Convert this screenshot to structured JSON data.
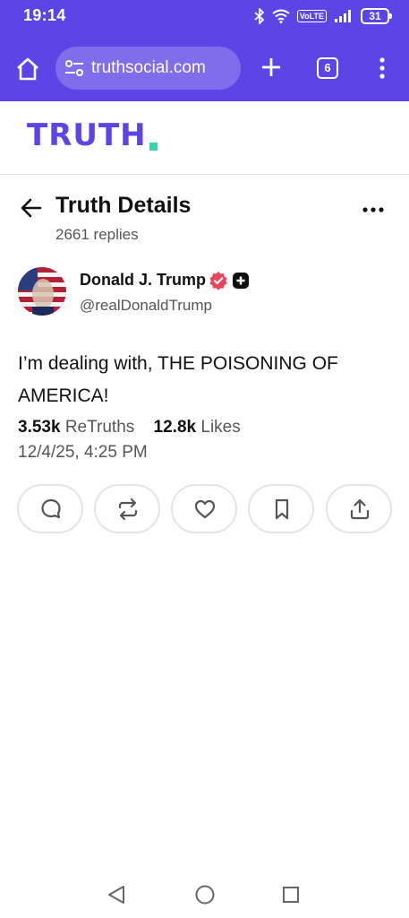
{
  "status_bar": {
    "time": "19:14",
    "network": "VoLTE",
    "battery": "31"
  },
  "browser": {
    "url": "truthsocial.com",
    "tab_count": "6"
  },
  "site": {
    "logo": "TRUTH",
    "brand_color": "#5b45e6",
    "accent_color": "#2fd6a8"
  },
  "page": {
    "title": "Truth Details",
    "replies": "2661 replies"
  },
  "post": {
    "author_name": "Donald J. Trump",
    "author_handle": "@realDonaldTrump",
    "text": "I’m dealing with, THE POISONING OF AMERICA!",
    "retruths_count": "3.53k",
    "retruths_label": "ReTruths",
    "likes_count": "12.8k",
    "likes_label": "Likes",
    "date": "12/4/25, 4:25 PM"
  },
  "icons": {
    "actions": [
      "reply-icon",
      "retruth-icon",
      "like-icon",
      "bookmark-icon",
      "share-icon"
    ]
  }
}
